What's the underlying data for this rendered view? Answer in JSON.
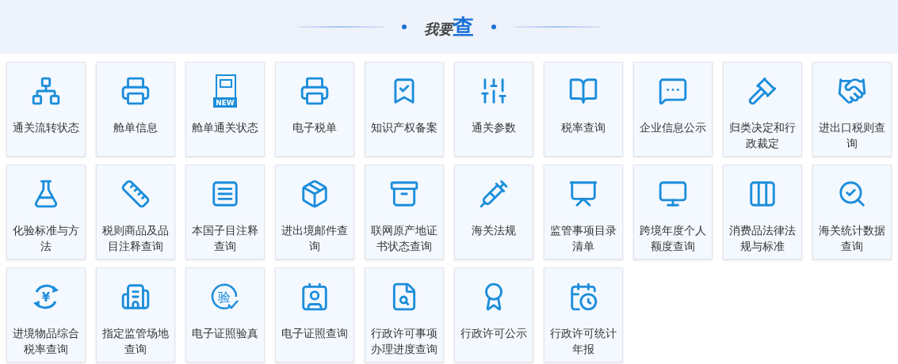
{
  "header": {
    "lead": "我要",
    "accent": "查"
  },
  "tiles": [
    {
      "label": "通关流转状态"
    },
    {
      "label": "舱单信息"
    },
    {
      "label": "舱单通关状态",
      "icon_text": "NEW"
    },
    {
      "label": "电子税单"
    },
    {
      "label": "知识产权备案"
    },
    {
      "label": "通关参数"
    },
    {
      "label": "税率查询"
    },
    {
      "label": "企业信息公示"
    },
    {
      "label": "归类决定和行政裁定"
    },
    {
      "label": "进出口税则查询"
    },
    {
      "label": "化验标准与方法"
    },
    {
      "label": "税则商品及品目注释查询"
    },
    {
      "label": "本国子目注释查询"
    },
    {
      "label": "进出境邮件查询"
    },
    {
      "label": "联网原产地证书状态查询"
    },
    {
      "label": "海关法规"
    },
    {
      "label": "监管事项目录清单"
    },
    {
      "label": "跨境年度个人额度查询"
    },
    {
      "label": "消费品法律法规与标准"
    },
    {
      "label": "海关统计数据查询"
    },
    {
      "label": "进境物品综合税率查询",
      "icon_text": "¥"
    },
    {
      "label": "指定监管场地查询"
    },
    {
      "label": "电子证照验真",
      "icon_text": "验"
    },
    {
      "label": "电子证照查询"
    },
    {
      "label": "行政许可事项办理进度查询"
    },
    {
      "label": "行政许可公示"
    },
    {
      "label": "行政许可统计年报"
    }
  ]
}
